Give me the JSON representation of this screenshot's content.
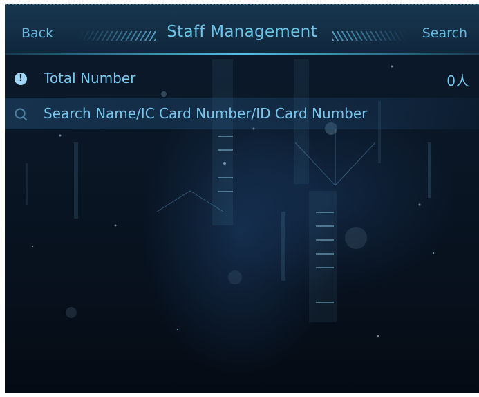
{
  "header": {
    "back_label": "Back",
    "title": "Staff Management",
    "search_label": "Search"
  },
  "summary": {
    "total_label": "Total Number",
    "total_value": "0人",
    "info_icon": "info-icon"
  },
  "search": {
    "placeholder": "Search Name/IC Card Number/ID Card Number",
    "icon": "search-icon"
  },
  "colors": {
    "accent": "#6cc4ea",
    "background": "#0a1625"
  }
}
